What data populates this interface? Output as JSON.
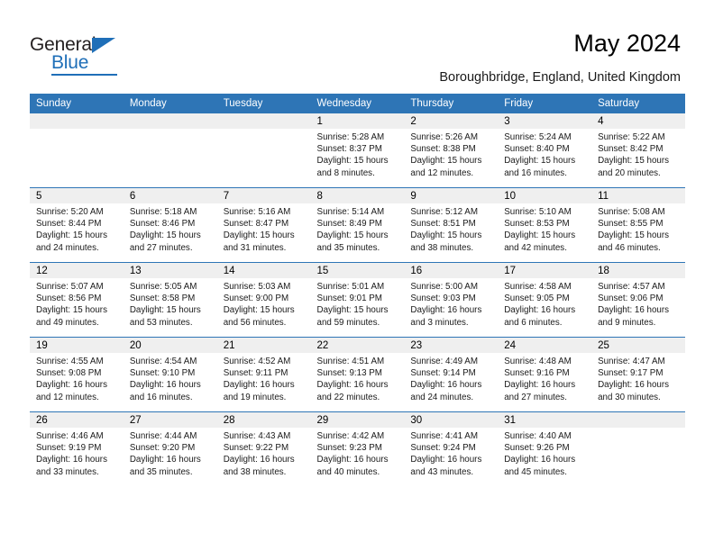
{
  "brand": {
    "name_top": "General",
    "name_bottom": "Blue",
    "accent_color": "#1F6FB8"
  },
  "header": {
    "title": "May 2024",
    "subtitle": "Boroughbridge, England, United Kingdom"
  },
  "calendar": {
    "header_bg": "#2E75B6",
    "daynum_bg": "#EFEFEF",
    "weekday_headers": [
      "Sunday",
      "Monday",
      "Tuesday",
      "Wednesday",
      "Thursday",
      "Friday",
      "Saturday"
    ],
    "labels": {
      "sunrise": "Sunrise:",
      "sunset": "Sunset:",
      "daylight": "Daylight:"
    },
    "weeks": [
      [
        {
          "day": "",
          "empty": true
        },
        {
          "day": "",
          "empty": true
        },
        {
          "day": "",
          "empty": true
        },
        {
          "day": "1",
          "sunrise": "Sunrise: 5:28 AM",
          "sunset": "Sunset: 8:37 PM",
          "daylight1": "Daylight: 15 hours",
          "daylight2": "and 8 minutes."
        },
        {
          "day": "2",
          "sunrise": "Sunrise: 5:26 AM",
          "sunset": "Sunset: 8:38 PM",
          "daylight1": "Daylight: 15 hours",
          "daylight2": "and 12 minutes."
        },
        {
          "day": "3",
          "sunrise": "Sunrise: 5:24 AM",
          "sunset": "Sunset: 8:40 PM",
          "daylight1": "Daylight: 15 hours",
          "daylight2": "and 16 minutes."
        },
        {
          "day": "4",
          "sunrise": "Sunrise: 5:22 AM",
          "sunset": "Sunset: 8:42 PM",
          "daylight1": "Daylight: 15 hours",
          "daylight2": "and 20 minutes."
        }
      ],
      [
        {
          "day": "5",
          "sunrise": "Sunrise: 5:20 AM",
          "sunset": "Sunset: 8:44 PM",
          "daylight1": "Daylight: 15 hours",
          "daylight2": "and 24 minutes."
        },
        {
          "day": "6",
          "sunrise": "Sunrise: 5:18 AM",
          "sunset": "Sunset: 8:46 PM",
          "daylight1": "Daylight: 15 hours",
          "daylight2": "and 27 minutes."
        },
        {
          "day": "7",
          "sunrise": "Sunrise: 5:16 AM",
          "sunset": "Sunset: 8:47 PM",
          "daylight1": "Daylight: 15 hours",
          "daylight2": "and 31 minutes."
        },
        {
          "day": "8",
          "sunrise": "Sunrise: 5:14 AM",
          "sunset": "Sunset: 8:49 PM",
          "daylight1": "Daylight: 15 hours",
          "daylight2": "and 35 minutes."
        },
        {
          "day": "9",
          "sunrise": "Sunrise: 5:12 AM",
          "sunset": "Sunset: 8:51 PM",
          "daylight1": "Daylight: 15 hours",
          "daylight2": "and 38 minutes."
        },
        {
          "day": "10",
          "sunrise": "Sunrise: 5:10 AM",
          "sunset": "Sunset: 8:53 PM",
          "daylight1": "Daylight: 15 hours",
          "daylight2": "and 42 minutes."
        },
        {
          "day": "11",
          "sunrise": "Sunrise: 5:08 AM",
          "sunset": "Sunset: 8:55 PM",
          "daylight1": "Daylight: 15 hours",
          "daylight2": "and 46 minutes."
        }
      ],
      [
        {
          "day": "12",
          "sunrise": "Sunrise: 5:07 AM",
          "sunset": "Sunset: 8:56 PM",
          "daylight1": "Daylight: 15 hours",
          "daylight2": "and 49 minutes."
        },
        {
          "day": "13",
          "sunrise": "Sunrise: 5:05 AM",
          "sunset": "Sunset: 8:58 PM",
          "daylight1": "Daylight: 15 hours",
          "daylight2": "and 53 minutes."
        },
        {
          "day": "14",
          "sunrise": "Sunrise: 5:03 AM",
          "sunset": "Sunset: 9:00 PM",
          "daylight1": "Daylight: 15 hours",
          "daylight2": "and 56 minutes."
        },
        {
          "day": "15",
          "sunrise": "Sunrise: 5:01 AM",
          "sunset": "Sunset: 9:01 PM",
          "daylight1": "Daylight: 15 hours",
          "daylight2": "and 59 minutes."
        },
        {
          "day": "16",
          "sunrise": "Sunrise: 5:00 AM",
          "sunset": "Sunset: 9:03 PM",
          "daylight1": "Daylight: 16 hours",
          "daylight2": "and 3 minutes."
        },
        {
          "day": "17",
          "sunrise": "Sunrise: 4:58 AM",
          "sunset": "Sunset: 9:05 PM",
          "daylight1": "Daylight: 16 hours",
          "daylight2": "and 6 minutes."
        },
        {
          "day": "18",
          "sunrise": "Sunrise: 4:57 AM",
          "sunset": "Sunset: 9:06 PM",
          "daylight1": "Daylight: 16 hours",
          "daylight2": "and 9 minutes."
        }
      ],
      [
        {
          "day": "19",
          "sunrise": "Sunrise: 4:55 AM",
          "sunset": "Sunset: 9:08 PM",
          "daylight1": "Daylight: 16 hours",
          "daylight2": "and 12 minutes."
        },
        {
          "day": "20",
          "sunrise": "Sunrise: 4:54 AM",
          "sunset": "Sunset: 9:10 PM",
          "daylight1": "Daylight: 16 hours",
          "daylight2": "and 16 minutes."
        },
        {
          "day": "21",
          "sunrise": "Sunrise: 4:52 AM",
          "sunset": "Sunset: 9:11 PM",
          "daylight1": "Daylight: 16 hours",
          "daylight2": "and 19 minutes."
        },
        {
          "day": "22",
          "sunrise": "Sunrise: 4:51 AM",
          "sunset": "Sunset: 9:13 PM",
          "daylight1": "Daylight: 16 hours",
          "daylight2": "and 22 minutes."
        },
        {
          "day": "23",
          "sunrise": "Sunrise: 4:49 AM",
          "sunset": "Sunset: 9:14 PM",
          "daylight1": "Daylight: 16 hours",
          "daylight2": "and 24 minutes."
        },
        {
          "day": "24",
          "sunrise": "Sunrise: 4:48 AM",
          "sunset": "Sunset: 9:16 PM",
          "daylight1": "Daylight: 16 hours",
          "daylight2": "and 27 minutes."
        },
        {
          "day": "25",
          "sunrise": "Sunrise: 4:47 AM",
          "sunset": "Sunset: 9:17 PM",
          "daylight1": "Daylight: 16 hours",
          "daylight2": "and 30 minutes."
        }
      ],
      [
        {
          "day": "26",
          "sunrise": "Sunrise: 4:46 AM",
          "sunset": "Sunset: 9:19 PM",
          "daylight1": "Daylight: 16 hours",
          "daylight2": "and 33 minutes."
        },
        {
          "day": "27",
          "sunrise": "Sunrise: 4:44 AM",
          "sunset": "Sunset: 9:20 PM",
          "daylight1": "Daylight: 16 hours",
          "daylight2": "and 35 minutes."
        },
        {
          "day": "28",
          "sunrise": "Sunrise: 4:43 AM",
          "sunset": "Sunset: 9:22 PM",
          "daylight1": "Daylight: 16 hours",
          "daylight2": "and 38 minutes."
        },
        {
          "day": "29",
          "sunrise": "Sunrise: 4:42 AM",
          "sunset": "Sunset: 9:23 PM",
          "daylight1": "Daylight: 16 hours",
          "daylight2": "and 40 minutes."
        },
        {
          "day": "30",
          "sunrise": "Sunrise: 4:41 AM",
          "sunset": "Sunset: 9:24 PM",
          "daylight1": "Daylight: 16 hours",
          "daylight2": "and 43 minutes."
        },
        {
          "day": "31",
          "sunrise": "Sunrise: 4:40 AM",
          "sunset": "Sunset: 9:26 PM",
          "daylight1": "Daylight: 16 hours",
          "daylight2": "and 45 minutes."
        },
        {
          "day": "",
          "empty": true
        }
      ]
    ]
  }
}
